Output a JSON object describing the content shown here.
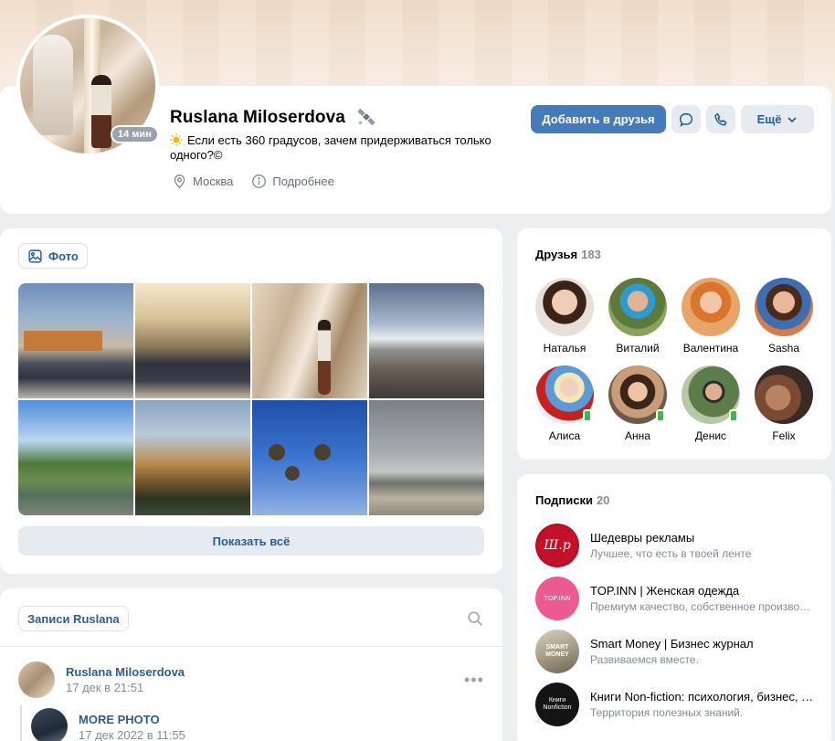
{
  "profile": {
    "name": "Ruslana Miloserdova",
    "online": "14 мин",
    "status": "Если есть 360 градусов, зачем придерживаться только одного?©",
    "city": "Москва",
    "details": "Подробнее"
  },
  "actions": {
    "add_friend": "Добавить в друзья",
    "more": "Ещё"
  },
  "photos": {
    "tab": "Фото",
    "show_all": "Показать всё"
  },
  "posts": {
    "tab": "Записи Ruslana",
    "items": [
      {
        "author": "Ruslana Miloserdova",
        "date": "17 дек в 21:51"
      },
      {
        "author": "MORE PHOTO",
        "date": "17 дек 2022 в 11:55"
      }
    ]
  },
  "friends": {
    "title": "Друзья",
    "count": "183",
    "items": [
      {
        "name": "Наталья"
      },
      {
        "name": "Виталий"
      },
      {
        "name": "Валентина"
      },
      {
        "name": "Sasha"
      },
      {
        "name": "Алиса"
      },
      {
        "name": "Анна"
      },
      {
        "name": "Денис"
      },
      {
        "name": "Felix"
      }
    ]
  },
  "subscriptions": {
    "title": "Подписки",
    "count": "20",
    "items": [
      {
        "name": "Шедевры рекламы",
        "desc": "Лучшее, что есть в твоей ленте",
        "logo": "Ш.р"
      },
      {
        "name": "TOP.INN | Женская одежда",
        "desc": "Премиум качество, собственное производство",
        "logo": "TOP.INN"
      },
      {
        "name": "Smart Money | Бизнес журнал",
        "desc": "Развиваемся вместе.",
        "logo": "SMART MONEY"
      },
      {
        "name": "Книги Non-fiction: психология, бизнес, саморазвитие",
        "desc": "Территория полезных знаний.",
        "logo": "Книги Nonfiction"
      }
    ]
  },
  "colors": {
    "accent": "#447bba",
    "link": "#2c5d8f",
    "secondary": "#818c99",
    "background": "#edeef0"
  }
}
